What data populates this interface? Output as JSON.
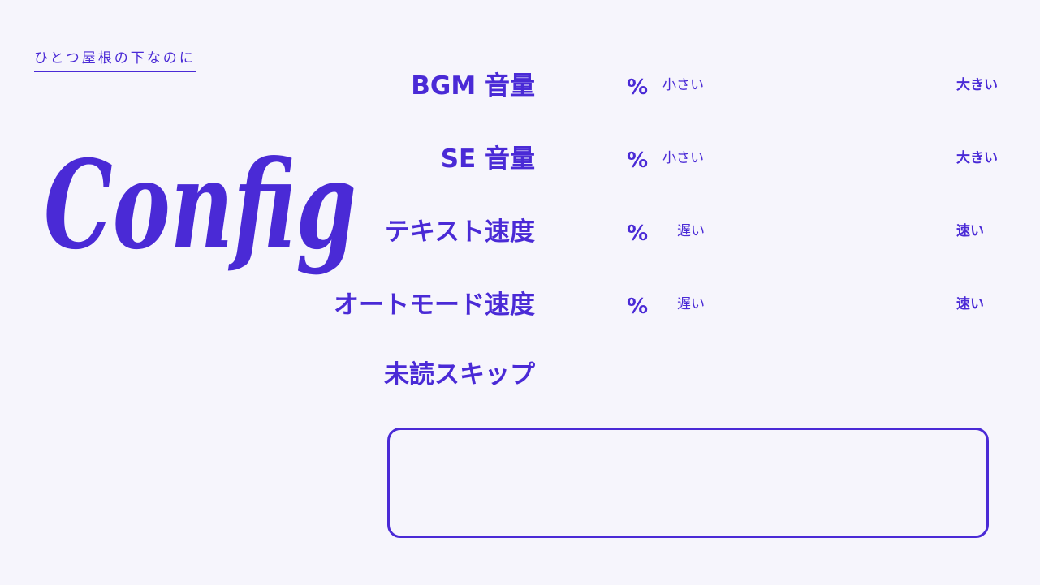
{
  "logo_text": "ひとつ屋根の下なのに",
  "title": "Config",
  "settings": [
    {
      "label": "BGM 音量",
      "unit": "%",
      "low": "小さい",
      "high": "大きい"
    },
    {
      "label": "SE 音量",
      "unit": "%",
      "low": "小さい",
      "high": "大きい"
    },
    {
      "label": "テキスト速度",
      "unit": "%",
      "low": "遅い",
      "high": "速い"
    },
    {
      "label": "オートモード速度",
      "unit": "%",
      "low": "遅い",
      "high": "速い"
    },
    {
      "label": "未読スキップ"
    }
  ],
  "colors": {
    "accent": "#4a2ad6",
    "background": "#f6f5fc"
  }
}
